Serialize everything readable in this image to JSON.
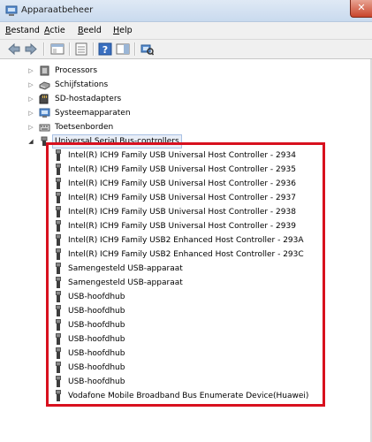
{
  "window": {
    "title": "Apparaatbeheer",
    "close_glyph": "✕"
  },
  "menu": [
    {
      "u": "B",
      "rest": "estand"
    },
    {
      "u": "A",
      "rest": "ctie"
    },
    {
      "u": "B",
      "rest": "eeld"
    },
    {
      "u": "H",
      "rest": "elp"
    }
  ],
  "toolbar": {
    "icons": [
      "back-arrow-icon",
      "forward-arrow-icon",
      "show-hide-tree-icon",
      "properties-icon",
      "help-icon",
      "action-pane-icon",
      "scan-hardware-icon"
    ]
  },
  "tree": {
    "categories": [
      {
        "label": "Processors",
        "icon": "processor-icon"
      },
      {
        "label": "Schijfstations",
        "icon": "disk-drive-icon"
      },
      {
        "label": "SD-hostadapters",
        "icon": "sd-host-icon"
      },
      {
        "label": "Systeemapparaten",
        "icon": "system-devices-icon"
      },
      {
        "label": "Toetsenborden",
        "icon": "keyboard-icon"
      }
    ],
    "usb": {
      "label": "Universal Serial Bus-controllers",
      "expand_glyph": "◢",
      "collapsed_glyph": "▷",
      "children": [
        "Intel(R) ICH9 Family USB Universal Host Controller - 2934",
        "Intel(R) ICH9 Family USB Universal Host Controller - 2935",
        "Intel(R) ICH9 Family USB Universal Host Controller - 2936",
        "Intel(R) ICH9 Family USB Universal Host Controller - 2937",
        "Intel(R) ICH9 Family USB Universal Host Controller - 2938",
        "Intel(R) ICH9 Family USB Universal Host Controller - 2939",
        "Intel(R) ICH9 Family USB2 Enhanced Host Controller - 293A",
        "Intel(R) ICH9 Family USB2 Enhanced Host Controller - 293C",
        "Samengesteld USB-apparaat",
        "Samengesteld USB-apparaat",
        "USB-hoofdhub",
        "USB-hoofdhub",
        "USB-hoofdhub",
        "USB-hoofdhub",
        "USB-hoofdhub",
        "USB-hoofdhub",
        "USB-hoofdhub",
        "Vodafone Mobile Broadband Bus Enumerate Device(Huawei)"
      ]
    }
  },
  "colors": {
    "highlight": "#d8101e"
  }
}
